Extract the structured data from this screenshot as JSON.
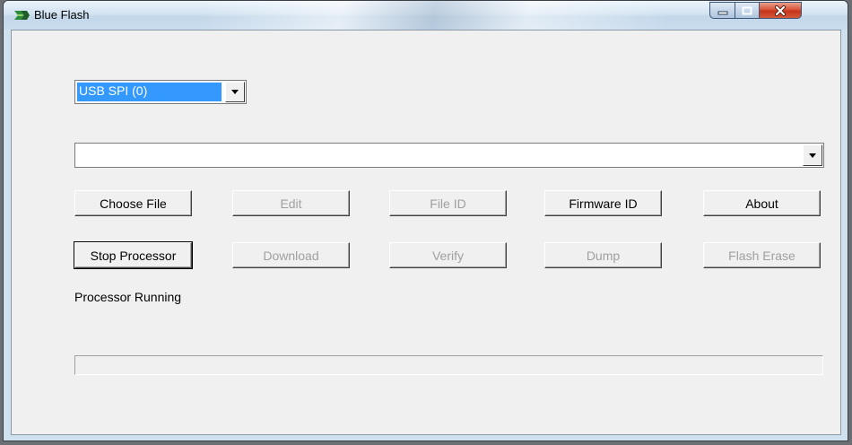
{
  "window": {
    "title": "Blue Flash",
    "controls": {
      "minimize": "minimize",
      "maximize": "maximize",
      "close": "close"
    }
  },
  "interface_select": {
    "value": "USB SPI (0)"
  },
  "file_select": {
    "value": ""
  },
  "buttons": {
    "row1": [
      {
        "label": "Choose File",
        "enabled": true
      },
      {
        "label": "Edit",
        "enabled": false
      },
      {
        "label": "File ID",
        "enabled": false
      },
      {
        "label": "Firmware ID",
        "enabled": true
      },
      {
        "label": "About",
        "enabled": true
      }
    ],
    "row2": [
      {
        "label": "Stop Processor",
        "enabled": true
      },
      {
        "label": "Download",
        "enabled": false
      },
      {
        "label": "Verify",
        "enabled": false
      },
      {
        "label": "Dump",
        "enabled": false
      },
      {
        "label": "Flash Erase",
        "enabled": false
      }
    ]
  },
  "status": {
    "text": "Processor Running"
  },
  "progress": {
    "value": 0
  },
  "colors": {
    "selection": "#3399ff",
    "disabled_text": "#a0a0a0",
    "close_button": "#c4341b"
  },
  "icons": {
    "app": "blue-flash-app-icon"
  }
}
